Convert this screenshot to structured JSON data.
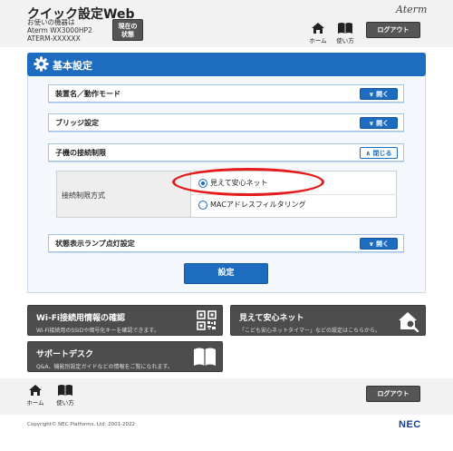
{
  "header": {
    "app_title": "クイック設定Web",
    "model_info": [
      "お使いの機器は",
      "Aterm  WX3000HP2",
      "ATERM-XXXXXX"
    ],
    "status_button": [
      "現在の",
      "状態"
    ],
    "brand": "Aterm",
    "home_label": "ホーム",
    "howto_label": "使い方",
    "logout_label": "ログアウト"
  },
  "panel": {
    "title": "基本設定",
    "sections": [
      {
        "label": "装置名／動作モード",
        "toggle": "開く"
      },
      {
        "label": "ブリッジ設定",
        "toggle": "開く"
      },
      {
        "label": "子機の接続制限",
        "toggle": "閉じる"
      },
      {
        "label": "状態表示ランプ点灯設定",
        "toggle": "開く"
      }
    ],
    "setting": {
      "label": "接続制限方式",
      "options": [
        "見えて安心ネット",
        "MACアドレスフィルタリング"
      ],
      "selected": "見えて安心ネット"
    },
    "apply_label": "設定"
  },
  "tiles": [
    {
      "title": "Wi-Fi接続用情報の確認",
      "desc": "Wi-Fi接続用のSSIDや暗号化キーを確認できます。",
      "icon": "qr-code-icon"
    },
    {
      "title": "見えて安心ネット",
      "desc": "「こども安心ネットタイマー」などの設定はこちらから。",
      "icon": "house-search-icon"
    },
    {
      "title": "サポートデスク",
      "desc": "Q&A、機能別設定ガイドなどの情報をご覧になれます。",
      "icon": "open-book-icon"
    }
  ],
  "footer": {
    "home_label": "ホーム",
    "howto_label": "使い方",
    "logout_label": "ログアウト",
    "copyright": "Copyright© NEC Platforms, Ltd. 2001-2022",
    "logo": "NEC"
  },
  "colors": {
    "accent": "#1e6cc0",
    "highlight": "#e31b1b",
    "tile": "#4d4d4d"
  }
}
